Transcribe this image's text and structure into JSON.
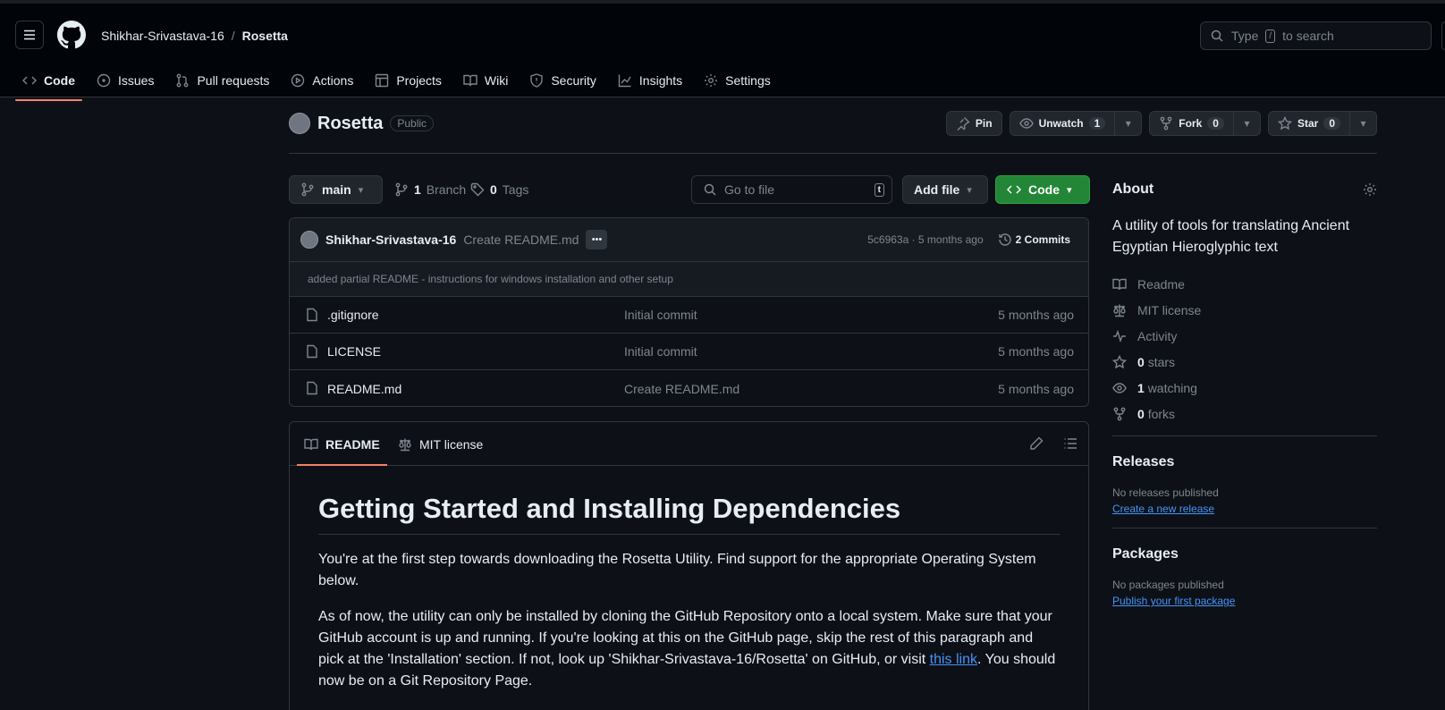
{
  "header": {
    "owner": "Shikhar-Srivastava-16",
    "separator": "/",
    "repo": "Rosetta",
    "search_prefix": "Type",
    "search_key": "/",
    "search_suffix": "to search"
  },
  "nav_tabs": [
    {
      "label": "Code",
      "icon": "code-icon"
    },
    {
      "label": "Issues",
      "icon": "issue-icon"
    },
    {
      "label": "Pull requests",
      "icon": "pull-request-icon"
    },
    {
      "label": "Actions",
      "icon": "play-icon"
    },
    {
      "label": "Projects",
      "icon": "table-icon"
    },
    {
      "label": "Wiki",
      "icon": "book-icon"
    },
    {
      "label": "Security",
      "icon": "shield-icon"
    },
    {
      "label": "Insights",
      "icon": "graph-icon"
    },
    {
      "label": "Settings",
      "icon": "gear-icon"
    }
  ],
  "repo_head": {
    "name": "Rosetta",
    "visibility": "Public",
    "pin_label": "Pin",
    "unwatch_label": "Unwatch",
    "watch_count": "1",
    "fork_label": "Fork",
    "fork_count": "0",
    "star_label": "Star",
    "star_count": "0"
  },
  "toolbar": {
    "branch": "main",
    "branch_count": "1",
    "branch_label": "Branch",
    "tag_count": "0",
    "tag_label": "Tags",
    "goto_placeholder": "Go to file",
    "goto_key": "t",
    "add_file": "Add file",
    "code": "Code"
  },
  "commit": {
    "author": "Shikhar-Srivastava-16",
    "message": "Create README.md",
    "ellipsis": "•••",
    "meta": "5c6963a · 5 months ago",
    "commits_label": "2 Commits",
    "description": "added partial README - instructions for windows installation and other setup"
  },
  "files": [
    {
      "name": ".gitignore",
      "message": "Initial commit",
      "date": "5 months ago"
    },
    {
      "name": "LICENSE",
      "message": "Initial commit",
      "date": "5 months ago"
    },
    {
      "name": "README.md",
      "message": "Create README.md",
      "date": "5 months ago"
    }
  ],
  "readme": {
    "tab_readme": "README",
    "tab_license": "MIT license",
    "heading": "Getting Started and Installing Dependencies",
    "para1": "You're at the first step towards downloading the Rosetta Utility. Find support for the appropriate Operating System below.",
    "para2_before": "As of now, the utility can only be installed by cloning the GitHub Repository onto a local system. Make sure that your GitHub account is up and running. If you're looking at this on the GitHub page, skip the rest of this paragraph and pick at the 'Installation' section. If not, look up 'Shikhar-Srivastava-16/Rosetta' on GitHub, or visit ",
    "para2_link": "this link",
    "para2_after": ". You should now be on a Git Repository Page."
  },
  "about": {
    "title": "About",
    "description": "A utility of tools for translating Ancient Egyptian Hieroglyphic text",
    "readme": "Readme",
    "license": "MIT license",
    "activity": "Activity",
    "stars_count": "0",
    "stars_label": "stars",
    "watching_count": "1",
    "watching_label": "watching",
    "forks_count": "0",
    "forks_label": "forks"
  },
  "releases": {
    "title": "Releases",
    "empty": "No releases published",
    "link": "Create a new release"
  },
  "packages": {
    "title": "Packages",
    "empty": "No packages published",
    "link": "Publish your first package"
  },
  "colors": {
    "background": "#0d1117",
    "accent_tab": "#f78166",
    "green_button": "#238636",
    "link": "#4493f8"
  }
}
